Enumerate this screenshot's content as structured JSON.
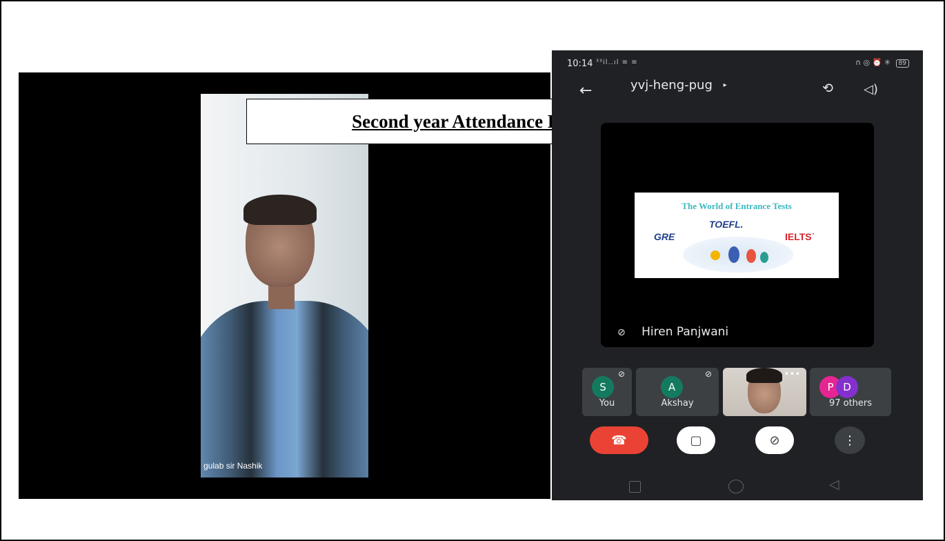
{
  "document": {
    "title": "Second year Attendance Proof"
  },
  "left_feed": {
    "label": "gulab sir Nashik"
  },
  "phone": {
    "status": {
      "time": "10:14",
      "signal_text": "³³il..ıl ≡ ≡",
      "right_icons": "∩ ◎ ⏰ ✳",
      "battery": "89"
    },
    "meeting": {
      "code": "yvj-heng-pug",
      "caret": "▸"
    },
    "icons": {
      "back": "←",
      "switch_camera": "⟲",
      "speaker": "◁)"
    },
    "presentation": {
      "slide_title": "The World of Entrance Tests",
      "toefl": "TOEFL.",
      "gre": "GRE",
      "ielts": "IELTS˙",
      "presenter": "Hiren Panjwani"
    },
    "participants": [
      {
        "initial": "S",
        "name": "You",
        "color": "#137a60"
      },
      {
        "initial": "A",
        "name": "Akshay",
        "color": "#137a60"
      },
      {
        "initial": "P",
        "color": "#e52592"
      },
      {
        "initial": "D",
        "color": "#8430ce"
      }
    ],
    "others_label": "97 others",
    "controls": {
      "end_call": "☎",
      "camera_off": "▢",
      "mic_off": "⊘",
      "more": "⋮"
    }
  }
}
